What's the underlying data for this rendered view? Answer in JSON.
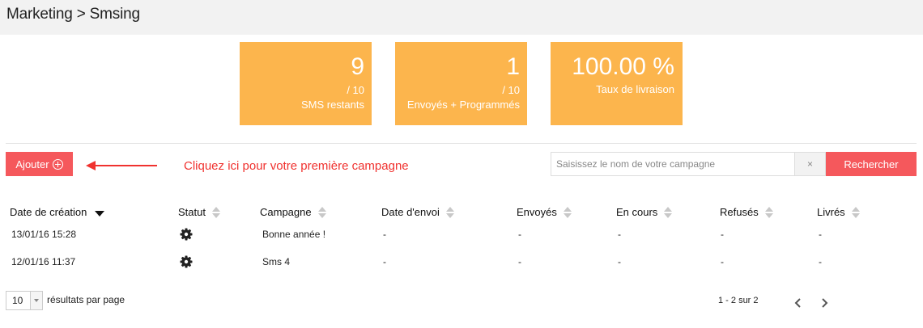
{
  "breadcrumb": "Marketing > Smsing",
  "stats": [
    {
      "value": "9",
      "total": "/ 10",
      "label": "SMS restants"
    },
    {
      "value": "1",
      "total": "/ 10",
      "label": "Envoyés + Programmés"
    },
    {
      "value": "100.00 %",
      "label": "Taux de livraison"
    }
  ],
  "toolbar": {
    "add_label": "Ajouter",
    "hint": "Cliquez ici pour votre première campagne",
    "search_placeholder": "Saisissez le nom de votre campagne",
    "clear_label": "×",
    "search_label": "Rechercher"
  },
  "table": {
    "columns": [
      "Date de création",
      "Statut",
      "Campagne",
      "Date d'envoi",
      "Envoyés",
      "En cours",
      "Refusés",
      "Livrés"
    ],
    "rows": [
      {
        "date": "13/01/16 15:28",
        "status": "gear-icon",
        "campaign": "Bonne année !",
        "send_date": "-",
        "sent": "-",
        "in_progress": "-",
        "refused": "-",
        "delivered": "-"
      },
      {
        "date": "12/01/16 11:37",
        "status": "gear-icon",
        "campaign": "Sms 4",
        "send_date": "-",
        "sent": "-",
        "in_progress": "-",
        "refused": "-",
        "delivered": "-"
      }
    ]
  },
  "footer": {
    "per_page": "10",
    "per_page_label": "résultats par page",
    "pagination_info": "1 - 2 sur 2"
  },
  "colors": {
    "stat_bg": "#fcb54d",
    "accent_red": "#f5585c",
    "hint_red": "#f0322f"
  }
}
